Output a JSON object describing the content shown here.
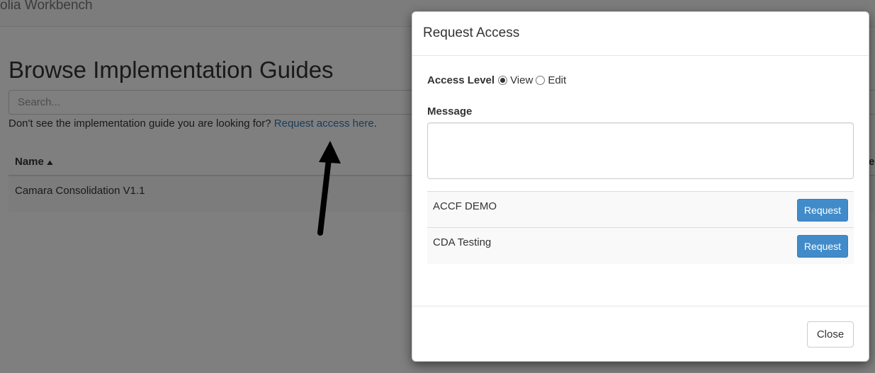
{
  "app": {
    "brand": "olia Workbench"
  },
  "page": {
    "title": "Browse Implementation Guides",
    "search_placeholder": "Search...",
    "help_text": "Don't see the implementation guide you are looking for?",
    "help_link": "Request access here",
    "help_suffix": ".",
    "table": {
      "headers": {
        "name": "Name",
        "name_sort_icon": "chevron-up-icon",
        "edge": "e"
      },
      "rows": [
        "Camara Consolidation V1.1"
      ]
    }
  },
  "modal": {
    "title": "Request Access",
    "access_level_label": "Access Level",
    "options": {
      "view": "View",
      "edit": "Edit",
      "selected": "view"
    },
    "message_label": "Message",
    "message_value": "",
    "guides": [
      {
        "name": "ACCF DEMO",
        "button": "Request"
      },
      {
        "name": "CDA Testing",
        "button": "Request"
      }
    ],
    "close_label": "Close"
  },
  "colors": {
    "primary": "#428bca",
    "link": "#337ab7",
    "backdrop": "#000000"
  }
}
